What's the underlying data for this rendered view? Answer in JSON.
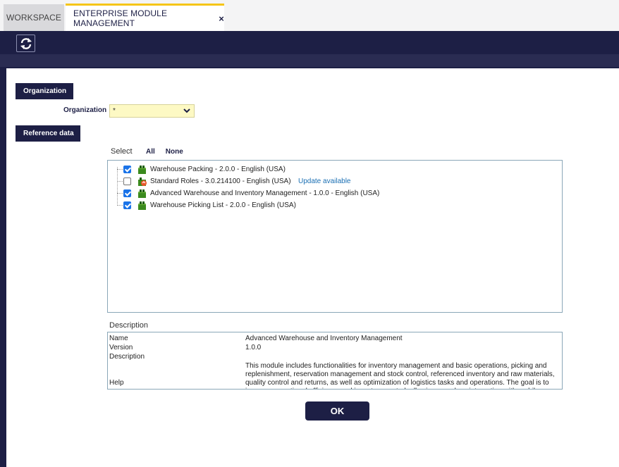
{
  "tabs": {
    "workspace": "WORKSPACE",
    "active": "ENTERPRISE MODULE MANAGEMENT",
    "close": "×"
  },
  "toolbar": {
    "refresh_icon": "refresh-icon"
  },
  "organization_section": {
    "button": "Organization",
    "field_label": "Organization",
    "field_value": "*"
  },
  "reference_section": {
    "button": "Reference data",
    "select_label": "Select",
    "all": "All",
    "none": "None"
  },
  "modules": [
    {
      "label": "Warehouse Packing - 2.0.0 - English (USA)",
      "checked": true,
      "icon": "package-icon",
      "update": ""
    },
    {
      "label": "Standard Roles - 3.0.214100 - English (USA)",
      "checked": false,
      "icon": "package-update-icon",
      "update": "Update available"
    },
    {
      "label": "Advanced Warehouse and Inventory Management - 1.0.0 - English (USA)",
      "checked": true,
      "icon": "package-icon",
      "update": ""
    },
    {
      "label": "Warehouse Picking List - 2.0.0 - English (USA)",
      "checked": true,
      "icon": "package-icon",
      "update": ""
    }
  ],
  "description": {
    "title": "Description",
    "name_key": "Name",
    "name_value": "Advanced Warehouse and Inventory Management",
    "version_key": "Version",
    "version_value": "1.0.0",
    "description_key": "Description",
    "description_value": "This module includes functionalities for inventory management and basic operations, picking and replenishment, reservation management and stock control, referenced inventory and raw materials, quality control and returns, as well as optimization of logistics tasks and operations. The goal is to improve operational efficiency and inventory control, allowing seamless integration with mobile devices",
    "help_key": "Help"
  },
  "ok_button": "OK",
  "colors": {
    "navy": "#1d1f45",
    "tab_accent": "#f5c518",
    "checkbox_blue": "#1a73e8",
    "link_blue": "#1a6fb3",
    "org_field_bg": "#fdf9c4"
  }
}
